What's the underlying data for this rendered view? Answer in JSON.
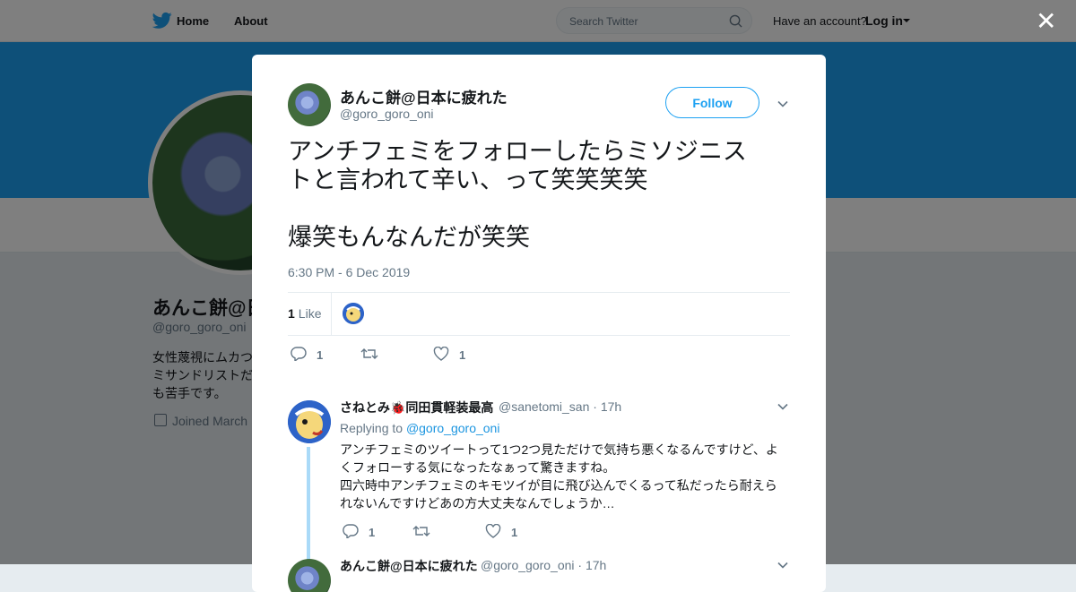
{
  "topnav": {
    "home_label": "Home",
    "about_label": "About",
    "search_placeholder": "Search Twitter",
    "account_prompt": "Have an account?",
    "login_label": "Log in"
  },
  "profile": {
    "name": "あんこ餅@日本に疲れた",
    "handle": "@goro_goro_oni",
    "bio_lines": [
      "女性蔑視にムカつ",
      "ミサンドリストだ",
      "も苦手です。"
    ],
    "joined": "Joined March"
  },
  "tweet": {
    "author_name": "あんこ餅@日本に疲れた",
    "author_handle": "@goro_goro_oni",
    "follow_label": "Follow",
    "text_lines": [
      "アンチフェミをフォローしたらミソジニス",
      "トと言われて辛い、って笑笑笑笑"
    ],
    "text_line2": "爆笑もんなんだが笑笑",
    "timestamp": "6:30 PM - 6 Dec 2019",
    "likes_count": "1",
    "likes_label": "Like",
    "reply_count": "1",
    "like_action_count": "1"
  },
  "reply": {
    "author_name": "さねとみ🐞同田貫軽装最高",
    "author_handle": "@sanetomi_san · 17h",
    "replying_prefix": "Replying to",
    "replying_to": "@goro_goro_oni",
    "text_lines": [
      "アンチフェミのツイートって1つ2つ見ただけで気持ち悪くなるんですけど、よ",
      "くフォローする気になったなぁって驚きますね。",
      "四六時中アンチフェミのキモツイが目に飛び込んでくるって私だったら耐えら",
      "れないんですけどあの方大丈夫なんでしょうか…"
    ],
    "reply_count": "1",
    "like_count": "1"
  },
  "reply2": {
    "author_name": "あんこ餅@日本に疲れた",
    "author_handle": "@goro_goro_oni · 17h"
  },
  "colors": {
    "brand": "#1da1f2",
    "link": "#1b95e0",
    "text": "#14171a",
    "muted": "#657786"
  }
}
